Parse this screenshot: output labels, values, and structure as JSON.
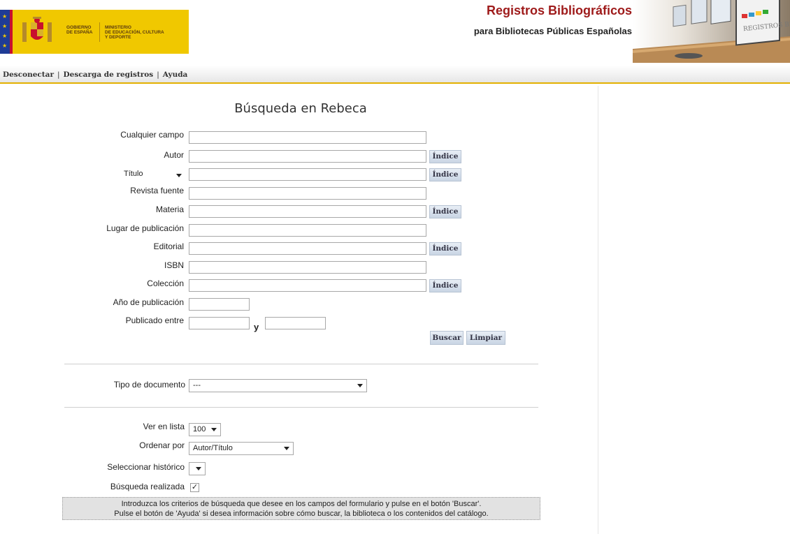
{
  "header": {
    "gov_logo_top": "GOBIERNO",
    "gov_logo_bottom": "DE ESPAÑA",
    "ministry_line1": "MINISTERIO",
    "ministry_line2": "DE EDUCACIÓN, CULTURA",
    "ministry_line3": "Y DEPORTE",
    "app_title": "Registros Bibliográficos",
    "app_subtitle": "para Bibliotecas Públicas Españolas",
    "banner_text": "REGISTROS BIBLIOGRÁFICOS"
  },
  "nav": {
    "items": [
      {
        "label": "Desconectar"
      },
      {
        "label": "Descarga de registros"
      },
      {
        "label": "Ayuda"
      }
    ],
    "separator": "|"
  },
  "search": {
    "title": "Búsqueda en Rebeca",
    "index_label": "Índice",
    "fields": {
      "any_field": {
        "label": "Cualquier campo",
        "value": ""
      },
      "author": {
        "label": "Autor",
        "value": ""
      },
      "title_selector": "Título",
      "title": {
        "value": ""
      },
      "journal": {
        "label": "Revista fuente",
        "value": ""
      },
      "subject": {
        "label": "Materia",
        "value": ""
      },
      "place": {
        "label": "Lugar de publicación",
        "value": ""
      },
      "publisher": {
        "label": "Editorial",
        "value": ""
      },
      "isbn": {
        "label": "ISBN",
        "value": ""
      },
      "collection": {
        "label": "Colección",
        "value": ""
      },
      "year": {
        "label": "Año de publicación",
        "value": ""
      },
      "between": {
        "label": "Publicado entre",
        "and_label": "y",
        "from": "",
        "to": ""
      }
    },
    "buttons": {
      "search": "Buscar",
      "clear": "Limpiar"
    }
  },
  "doc_type": {
    "label": "Tipo de documento",
    "value": "---"
  },
  "options": {
    "list_size": {
      "label": "Ver en lista",
      "value": "100"
    },
    "sort_by": {
      "label": "Ordenar por",
      "value": "Autor/Título"
    },
    "history": {
      "label": "Seleccionar histórico",
      "value": ""
    },
    "search_done": {
      "label": "Búsqueda realizada",
      "checked": true
    }
  },
  "info": {
    "line1": "Introduzca los criterios de búsqueda que desee en los campos del formulario y pulse en el botón 'Buscar'.",
    "line2": "Pulse el botón de 'Ayuda' si desea información sobre cómo buscar, la biblioteca o los contenidos del catálogo."
  },
  "colors": {
    "title_red": "#9e1a1a",
    "nav_underline": "#e3b000",
    "button_blue": "#c9d5e4",
    "logo_yellow": "#f0c800"
  }
}
